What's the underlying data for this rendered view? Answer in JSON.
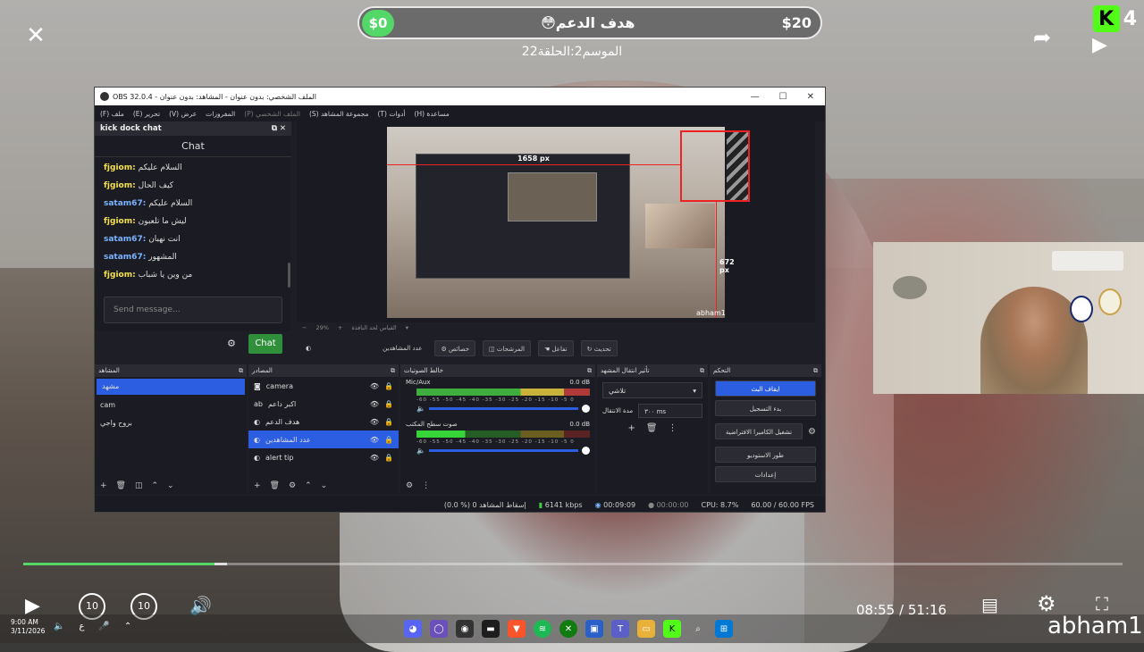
{
  "stream": {
    "goal_start": "$0",
    "goal_title": "😳هدف الدعم",
    "goal_end": "$20",
    "season_label": "الموسم2:الحلقة22",
    "viewer_badge": "K",
    "viewer_count": "4",
    "handle": "abham1"
  },
  "player": {
    "current_time": "08:55",
    "separator": "/",
    "duration": "51:16",
    "progress": 0.174,
    "skip_back": "10",
    "skip_forward": "10"
  },
  "obs": {
    "window_title": "OBS 32.0.4 - الملف الشخصي: بدون عنوان - المشاهد: بدون عنوان",
    "menu": [
      "(F) ملف",
      "(E) تحرير",
      "(V) عرض",
      "المفروزات",
      "(P) الملف الشخصي",
      "(S) مجموعة المشاهد",
      "(T) أدوات",
      "(H) مساعدة"
    ],
    "chat_dock": {
      "title": "kick dock chat",
      "header": "Chat",
      "messages": [
        {
          "user": "fjgiom:",
          "text": "السلام عليكم",
          "color": "#f4e04d"
        },
        {
          "user": "fjgiom:",
          "text": "كيف الحال",
          "color": "#f4e04d"
        },
        {
          "user": "satam67:",
          "text": "السلام عليكم",
          "color": "#7ab3ff"
        },
        {
          "user": "fjgiom:",
          "text": "ليش ما تلعبون",
          "color": "#f4e04d"
        },
        {
          "user": "satam67:",
          "text": "انت نهبان",
          "color": "#7ab3ff"
        },
        {
          "user": "satam67:",
          "text": "المشهور",
          "color": "#7ab3ff"
        },
        {
          "user": "fjgiom:",
          "text": "من وين يا شباب",
          "color": "#f4e04d"
        }
      ],
      "send_placeholder": "Send message...",
      "chat_button": "Chat"
    },
    "preview": {
      "width_label": "1658 px",
      "height_label": "672 px",
      "overlay_user": "abham1",
      "zoom": "29%",
      "fit_label": "القياس لحد النافذة"
    },
    "source_toolbar": {
      "selected_source": "عدد المشاهدين",
      "properties": "خصائص",
      "filters": "المرشحات",
      "interact": "تفاعل",
      "refresh": "تحديث"
    },
    "scenes": {
      "title": "المشاهد",
      "items": [
        "مشهد",
        "cam",
        "بروح واجي"
      ],
      "selected": 0
    },
    "sources": {
      "title": "المصادر",
      "items": [
        {
          "name": "camera",
          "icon": "camera-icon"
        },
        {
          "name": "اكبر داعم",
          "icon": "text-icon"
        },
        {
          "name": "هدف الدعم",
          "icon": "browser-icon"
        },
        {
          "name": "عدد المشاهدين",
          "icon": "browser-icon"
        },
        {
          "name": "alert tip",
          "icon": "browser-icon"
        }
      ],
      "selected": 3
    },
    "mixer": {
      "title": "خالط الصوتيات",
      "channels": [
        {
          "name": "Mic/Aux",
          "db": "0.0 dB"
        },
        {
          "name": "صوت سطح المكتب",
          "db": "0.0 dB"
        }
      ],
      "scale": "-60 -55 -50 -45 -40 -35 -30 -25 -20 -15 -10 -5 0"
    },
    "transitions": {
      "title": "تأثير انتقال المشهد",
      "type": "تلاشي",
      "duration_label": "مدة الانتقال",
      "duration": "٣٠٠ ms"
    },
    "controls": {
      "title": "التحكم",
      "stop_stream": "ايقاف البث",
      "start_recording": "بدء التسجيل",
      "virtual_camera": "تشغيل الكاميرا الافتراضية",
      "studio_mode": "طور الاستوديو",
      "settings": "إعدادات"
    },
    "status": {
      "dropped": "(0.0 %) إسقاط المشاهد 0",
      "bitrate": "6141 kbps",
      "stream_time": "00:09:09",
      "rec_time": "00:00:00",
      "cpu": "CPU: 8.7%",
      "fps": "60.00 / 60.00 FPS"
    }
  },
  "taskbar": {
    "time": "9:00 AM",
    "date": "3/11/2026",
    "lang": "ع"
  },
  "colors": {
    "accent": "#2c5ee2",
    "kick_green": "#53fc18",
    "goal_green": "#53d769"
  }
}
